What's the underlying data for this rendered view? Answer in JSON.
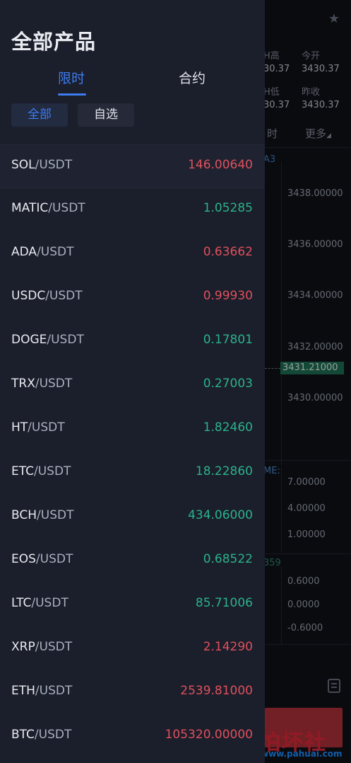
{
  "background": {
    "stats": [
      {
        "label": "H高",
        "value": "30.37"
      },
      {
        "label": "今开",
        "value": "3430.37"
      },
      {
        "label": "H低",
        "value": "30.37"
      },
      {
        "label": "昨收",
        "value": "3430.37"
      }
    ],
    "tab_left": "时",
    "tab_more": "更多",
    "ma_label": "A3",
    "prices": [
      "3438.00000",
      "3436.00000",
      "3434.00000",
      "3432.00000",
      "3430.00000"
    ],
    "current_price": "3431.21000",
    "vol_label": "ME:",
    "vol_ticks": [
      "7.00000",
      "4.00000",
      "1.00000"
    ],
    "macd_label": "359",
    "macd_ticks": [
      "0.6000",
      "0.0000",
      "-0.6000"
    ],
    "watermark_big": "怕坏社区",
    "watermark_small": "www.pahuai.com"
  },
  "drawer": {
    "title": "全部产品",
    "segments": [
      {
        "label": "限时",
        "active": true
      },
      {
        "label": "合约",
        "active": false
      }
    ],
    "chips": [
      {
        "label": "全部",
        "active": true
      },
      {
        "label": "自选",
        "active": false
      }
    ],
    "items": [
      {
        "base": "SOL",
        "quote": "/USDT",
        "price": "146.00640",
        "trend": "down"
      },
      {
        "base": "MATIC",
        "quote": "/USDT",
        "price": "1.05285",
        "trend": "up"
      },
      {
        "base": "ADA",
        "quote": "/USDT",
        "price": "0.63662",
        "trend": "down"
      },
      {
        "base": "USDC",
        "quote": "/USDT",
        "price": "0.99930",
        "trend": "down"
      },
      {
        "base": "DOGE",
        "quote": "/USDT",
        "price": "0.17801",
        "trend": "up"
      },
      {
        "base": "TRX",
        "quote": "/USDT",
        "price": "0.27003",
        "trend": "up"
      },
      {
        "base": "HT",
        "quote": "/USDT",
        "price": "1.82460",
        "trend": "up"
      },
      {
        "base": "ETC",
        "quote": "/USDT",
        "price": "18.22860",
        "trend": "up"
      },
      {
        "base": "BCH",
        "quote": "/USDT",
        "price": "434.06000",
        "trend": "up"
      },
      {
        "base": "EOS",
        "quote": "/USDT",
        "price": "0.68522",
        "trend": "up"
      },
      {
        "base": "LTC",
        "quote": "/USDT",
        "price": "85.71006",
        "trend": "up"
      },
      {
        "base": "XRP",
        "quote": "/USDT",
        "price": "2.14290",
        "trend": "down"
      },
      {
        "base": "ETH",
        "quote": "/USDT",
        "price": "2539.81000",
        "trend": "down"
      },
      {
        "base": "BTC",
        "quote": "/USDT",
        "price": "105320.00000",
        "trend": "down"
      }
    ]
  }
}
